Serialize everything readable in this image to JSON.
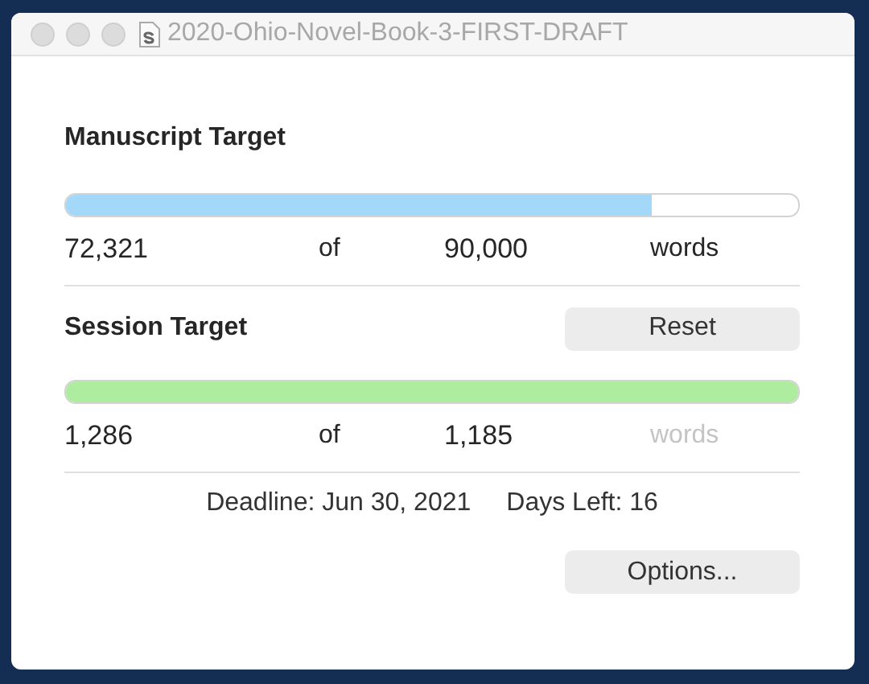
{
  "window": {
    "title": "2020-Ohio-Novel-Book-3-FIRST-DRAFT"
  },
  "targets": [
    {
      "title": "Manuscript Target",
      "color": "#a3d8f8",
      "level": 0.8,
      "count": "72,321",
      "of": "of",
      "goal": "90,000",
      "unit": "words",
      "unit_dimmed": false
    },
    {
      "title": "Session Target",
      "color": "#aeeca0",
      "level": 1,
      "count": "1,286",
      "of": "of",
      "goal": "1,185",
      "unit": "words",
      "unit_dimmed": true,
      "button": "Reset"
    }
  ],
  "deadline": "Deadline: Jun 30, 2021",
  "days_left": "Days Left: 16",
  "buttons": [
    "Options..."
  ]
}
